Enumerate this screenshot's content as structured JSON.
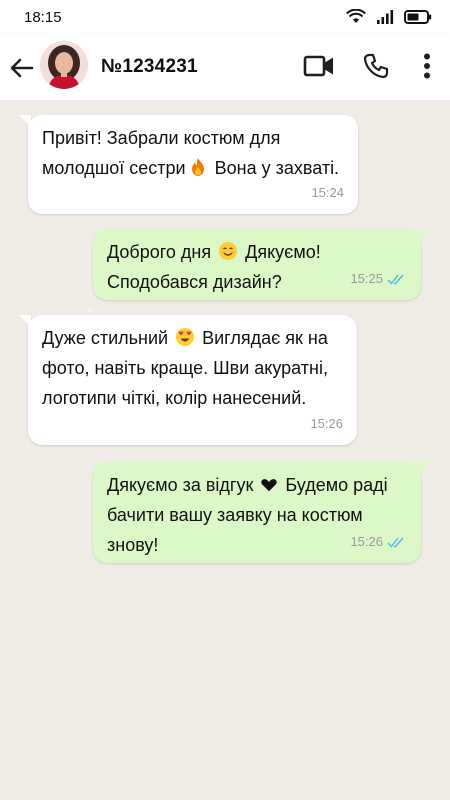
{
  "status_bar": {
    "time": "18:15",
    "icons": [
      "wifi-icon",
      "signal-icon",
      "battery-icon"
    ]
  },
  "header": {
    "contact_name": "№1234231",
    "icons": [
      "back-arrow-icon",
      "video-call-icon",
      "phone-icon",
      "more-vert-icon"
    ]
  },
  "colors": {
    "incoming_bubble": "#ffffff",
    "outgoing_bubble": "#dcf8c6",
    "chat_background": "#efebe5",
    "read_ticks": "#4fb6ec"
  },
  "messages": [
    {
      "direction": "incoming",
      "parts": [
        "Привіт! Забрали костюм для молодшої сестри",
        "Вона у захваті."
      ],
      "emoji": "fire-emoji",
      "time": "15:24"
    },
    {
      "direction": "outgoing",
      "parts": [
        "Доброго дня",
        "Дякуємо! Сподобався дизайн?"
      ],
      "emoji": "smiling-face-emoji",
      "time": "15:25",
      "status": "read"
    },
    {
      "direction": "incoming",
      "parts": [
        "Дуже стильний",
        "Виглядає як на фото, навіть краще. Шви акуратні, логотипи чіткі, колір нанесений."
      ],
      "emoji": "heart-eyes-emoji",
      "time": "15:26"
    },
    {
      "direction": "outgoing",
      "parts": [
        "Дякуємо за відгук",
        "Будемо раді бачити вашу заявку на костюм знову!"
      ],
      "emoji": "black-heart-emoji",
      "time": "15:26",
      "status": "read"
    }
  ]
}
